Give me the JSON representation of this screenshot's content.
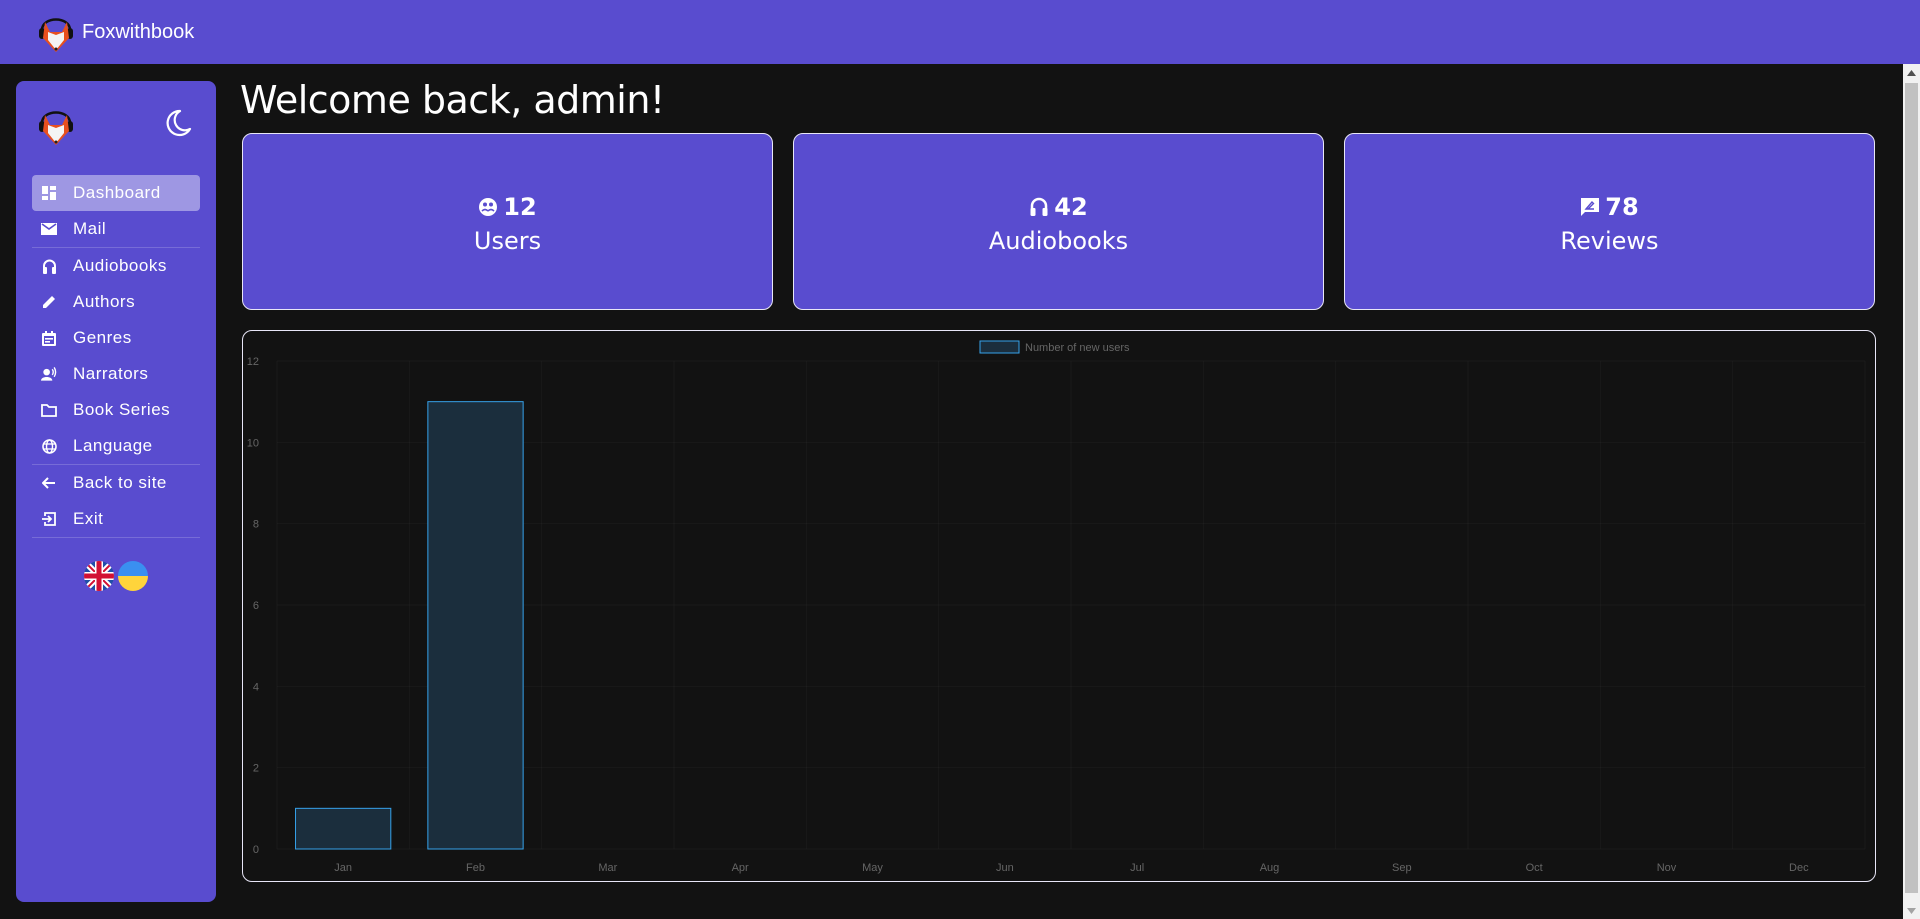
{
  "app": {
    "name": "Foxwithbook",
    "logo_icon": "fox-headphones-logo"
  },
  "sidebar": {
    "theme_toggle_icon": "moon-icon",
    "items": [
      {
        "label": "Dashboard",
        "icon": "dashboard-icon",
        "active": true
      },
      {
        "label": "Mail",
        "icon": "mail-icon",
        "active": false
      },
      {
        "label": "Audiobooks",
        "icon": "headphones-icon",
        "active": false
      },
      {
        "label": "Authors",
        "icon": "pencil-icon",
        "active": false
      },
      {
        "label": "Genres",
        "icon": "calendar-note-icon",
        "active": false
      },
      {
        "label": "Narrators",
        "icon": "voice-person-icon",
        "active": false
      },
      {
        "label": "Book Series",
        "icon": "folder-icon",
        "active": false
      },
      {
        "label": "Language",
        "icon": "globe-icon",
        "active": false
      },
      {
        "label": "Back to site",
        "icon": "arrow-left-icon",
        "active": false
      },
      {
        "label": "Exit",
        "icon": "exit-icon",
        "active": false
      }
    ],
    "languages": [
      {
        "code": "en",
        "icon": "uk-flag-icon"
      },
      {
        "code": "uk",
        "icon": "ukraine-flag-icon"
      }
    ]
  },
  "main": {
    "welcome": "Welcome back, admin!",
    "cards": [
      {
        "count": "12",
        "label": "Users",
        "icon": "users-face-icon"
      },
      {
        "count": "42",
        "label": "Audiobooks",
        "icon": "headphones-icon"
      },
      {
        "count": "78",
        "label": "Reviews",
        "icon": "review-icon"
      }
    ]
  },
  "colors": {
    "brand": "#594ccf",
    "background": "#121212",
    "bar_fill": "#1b2e3d",
    "bar_border": "#36a2eb",
    "tick_text": "#666666"
  },
  "chart_data": {
    "type": "bar",
    "title": "",
    "xlabel": "",
    "ylabel": "",
    "categories": [
      "Jan",
      "Feb",
      "Mar",
      "Apr",
      "May",
      "Jun",
      "Jul",
      "Aug",
      "Sep",
      "Oct",
      "Nov",
      "Dec"
    ],
    "series": [
      {
        "name": "Number of new users",
        "values": [
          1,
          11,
          0,
          0,
          0,
          0,
          0,
          0,
          0,
          0,
          0,
          0
        ]
      }
    ],
    "ylim": [
      0,
      12
    ],
    "yticks": [
      0,
      2,
      4,
      6,
      8,
      10,
      12
    ],
    "grid": true,
    "legend": "top-center"
  }
}
